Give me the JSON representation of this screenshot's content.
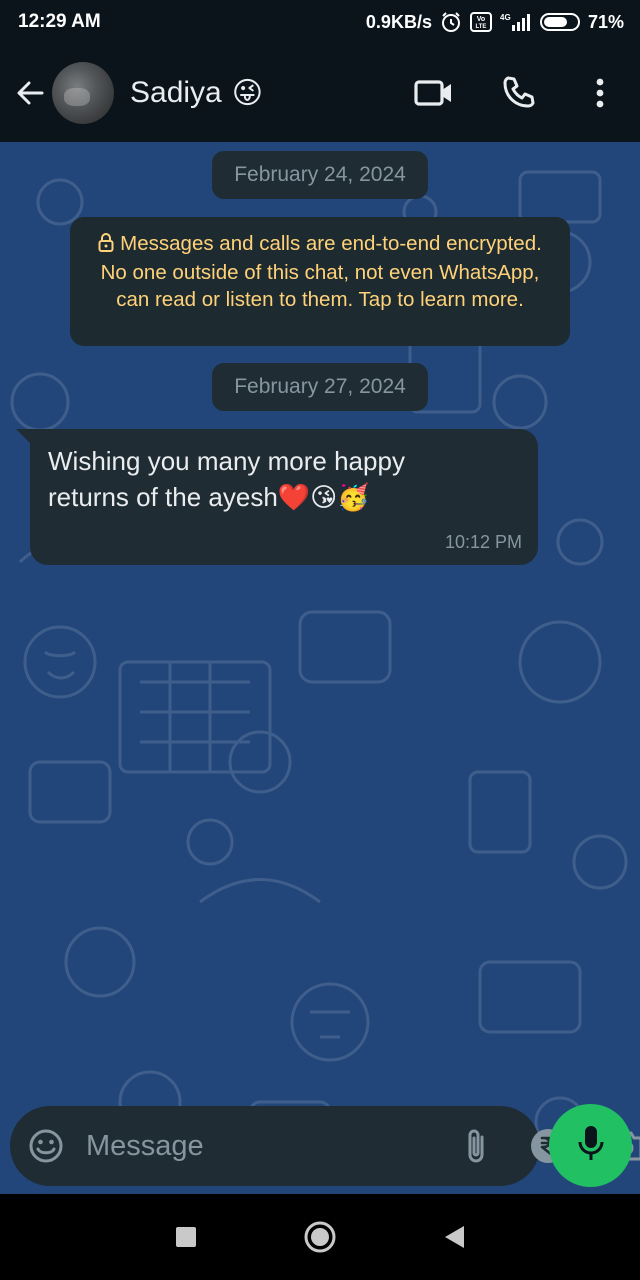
{
  "status_bar": {
    "time": "12:29 AM",
    "network_speed": "0.9KB/s",
    "volte_label": "Vo LTE",
    "network_type": "4G",
    "battery_percent": "71%",
    "battery_level": 0.71,
    "icons": [
      "alarm-icon",
      "volte-icon",
      "signal-icon",
      "battery-icon"
    ]
  },
  "header": {
    "contact_name": "Sadiya",
    "name_emoji": "😜",
    "icons": [
      "back-arrow-icon",
      "video-call-icon",
      "voice-call-icon",
      "more-options-icon"
    ]
  },
  "chat": {
    "date_separators": [
      "February 24, 2024",
      "February 27, 2024"
    ],
    "encryption_notice": "Messages and calls are end-to-end encrypted. No one outside of this chat, not even WhatsApp, can read or listen to them. Tap to learn more.",
    "messages": [
      {
        "direction": "incoming",
        "text": "Wishing you many more happy returns of the ayesh❤️😘🥳",
        "time": "10:12 PM"
      }
    ]
  },
  "input_bar": {
    "placeholder": "Message",
    "icons": [
      "emoji-icon",
      "attach-icon",
      "rupee-payment-icon",
      "camera-icon",
      "mic-icon"
    ]
  },
  "nav_bar": {
    "icons": [
      "recents-square-icon",
      "home-circle-icon",
      "back-triangle-icon"
    ]
  },
  "colors": {
    "chat_background": "#22467a",
    "bubble": "#202c33",
    "encryption_text": "#ffd279",
    "mic_button": "#21c063",
    "app_bar": "#0b141a"
  }
}
